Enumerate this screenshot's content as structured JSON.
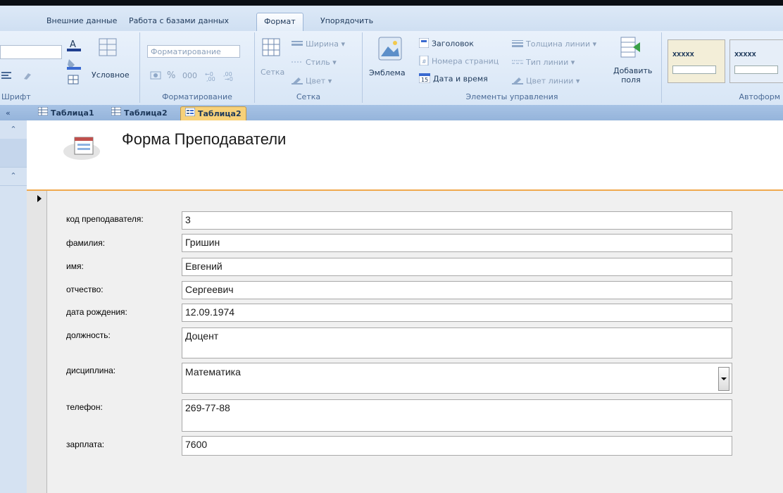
{
  "ribbon": {
    "tabs": [
      "Внешние данные",
      "Работа с базами данных",
      "Формат",
      "Упорядочить"
    ],
    "groups": {
      "font": {
        "label": "Шрифт",
        "conditional": "Условное"
      },
      "formatting": {
        "label": "Форматирование",
        "format_combo": "Форматирование",
        "percent": "%",
        "thousands": "000"
      },
      "grid": {
        "label": "Сетка",
        "big": "Сетка",
        "width": "Ширина",
        "style": "Стиль",
        "color": "Цвет"
      },
      "controls": {
        "label": "Элементы управления",
        "logo": "Эмблема",
        "heading": "Заголовок",
        "page_numbers": "Номера страниц",
        "date_time": "Дата и время",
        "line_thickness": "Толщина линии",
        "line_type": "Тип линии",
        "line_color": "Цвет линии",
        "add_fields": "Добавить поля"
      },
      "autoformat": {
        "label": "Автоформ"
      }
    }
  },
  "doc_tabs": [
    "Таблица1",
    "Таблица2",
    "Таблица2"
  ],
  "form": {
    "title": "Форма Преподаватели",
    "fields": [
      {
        "label": "код преподавателя:",
        "value": "3"
      },
      {
        "label": "фамилия:",
        "value": "Гришин"
      },
      {
        "label": "имя:",
        "value": "Евгений"
      },
      {
        "label": "отчество:",
        "value": "Сергеевич"
      },
      {
        "label": "дата рождения:",
        "value": "12.09.1974"
      },
      {
        "label": "должность:",
        "value": "Доцент"
      },
      {
        "label": "дисциплина:",
        "value": "Математика"
      },
      {
        "label": "телефон:",
        "value": "269-77-88"
      },
      {
        "label": "зарплата:",
        "value": "7600"
      }
    ]
  },
  "colors": {
    "accent": "#f0a94e",
    "active_tab": "#f7d179"
  }
}
